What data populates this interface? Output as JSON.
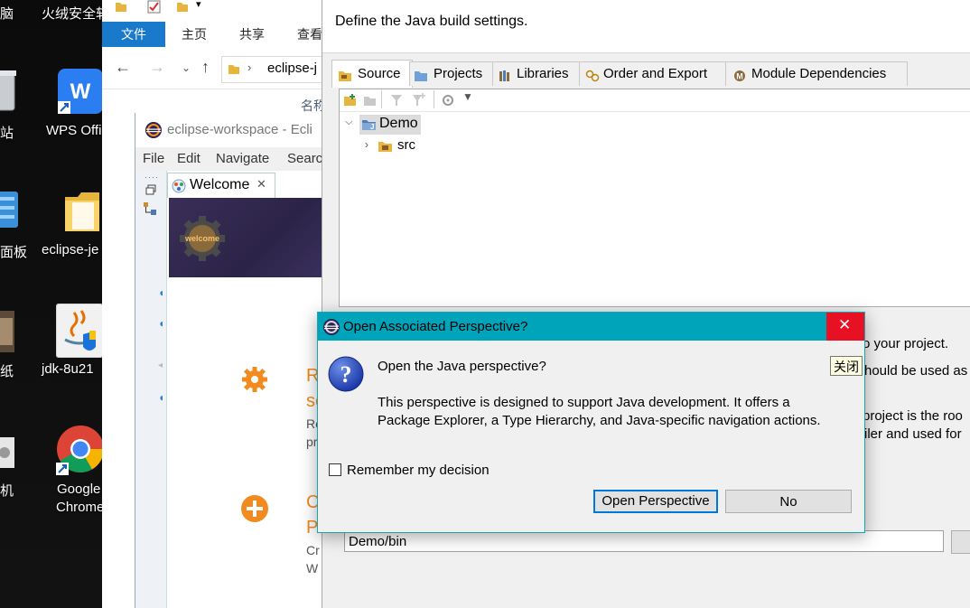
{
  "desktop": {
    "items": [
      {
        "label": "脑",
        "partial_of": "此电脑"
      },
      {
        "label": "火绒安全软"
      },
      {
        "label": "站"
      },
      {
        "label": "WPS Offi"
      },
      {
        "label": "面板"
      },
      {
        "label": "eclipse-je"
      },
      {
        "label": "纸"
      },
      {
        "label": "jdk-8u21"
      },
      {
        "label": "机"
      },
      {
        "label": "Google"
      },
      {
        "label": "Chrome"
      }
    ]
  },
  "explorer": {
    "ribbon_tabs": [
      "文件",
      "主页",
      "共享",
      "查看"
    ],
    "address": "eclipse-j",
    "column_header": "名称"
  },
  "eclipse": {
    "title": "eclipse-workspace - Ecli",
    "menu": [
      "File",
      "Edit",
      "Navigate",
      "Search"
    ],
    "welcome_tab": "Welcome",
    "banner_logo": "welcome",
    "items": [
      {
        "title": "R",
        "subtitle": "se",
        "desc1": "Re",
        "desc2": "pr"
      },
      {
        "title": "C",
        "subtitle": "P",
        "desc1": "Cr",
        "desc2": "W"
      }
    ]
  },
  "build_path": {
    "header": "Define the Java build settings.",
    "tabs": [
      "Source",
      "Projects",
      "Libraries",
      "Order and Export",
      "Module Dependencies"
    ],
    "tree": {
      "project": "Demo",
      "child": "src"
    },
    "text_fragments": [
      "o your project.",
      "hould be used as",
      "project is the roo",
      "iler and used for"
    ],
    "output_folder": "Demo/bin"
  },
  "dialog": {
    "title": "Open Associated Perspective?",
    "question": "Open the Java perspective?",
    "body_line1": "This perspective is designed to support Java development. It offers a",
    "body_line2": "Package Explorer, a Type Hierarchy, and Java-specific navigation actions.",
    "remember": "Remember my decision",
    "remember_checked": false,
    "open_button": "Open Perspective",
    "no_button": "No",
    "close_tooltip": "关闭",
    "colors": {
      "titlebar": "#00a4ba",
      "close": "#e81123",
      "default_border": "#0078d7"
    }
  }
}
